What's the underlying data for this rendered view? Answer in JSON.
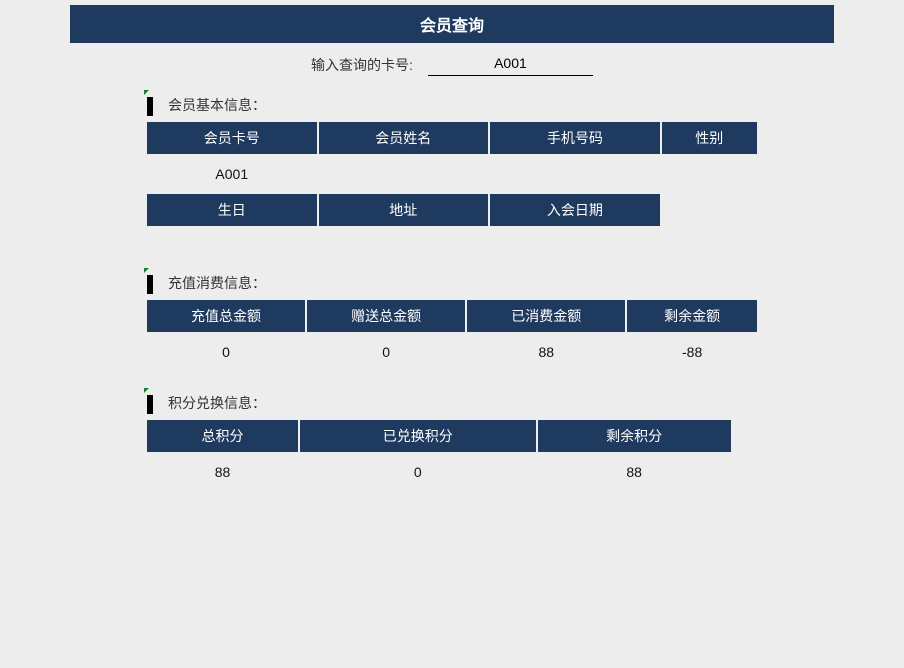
{
  "title": "会员查询",
  "search": {
    "label": "输入查询的卡号:",
    "value": "A001"
  },
  "sections": {
    "basic": {
      "title": "会员基本信息：",
      "row1_headers": [
        "会员卡号",
        "会员姓名",
        "手机号码",
        "性别"
      ],
      "row1_values": [
        "A001",
        "",
        "",
        ""
      ],
      "row2_headers": [
        "生日",
        "地址",
        "入会日期"
      ]
    },
    "recharge": {
      "title": "充值消费信息：",
      "headers": [
        "充值总金额",
        "赠送总金额",
        "已消费金额",
        "剩余金额"
      ],
      "values": [
        "0",
        "0",
        "88",
        "-88"
      ]
    },
    "points": {
      "title": "积分兑换信息：",
      "headers": [
        "总积分",
        "已兑换积分",
        "剩余积分"
      ],
      "values": [
        "88",
        "0",
        "88"
      ]
    }
  }
}
